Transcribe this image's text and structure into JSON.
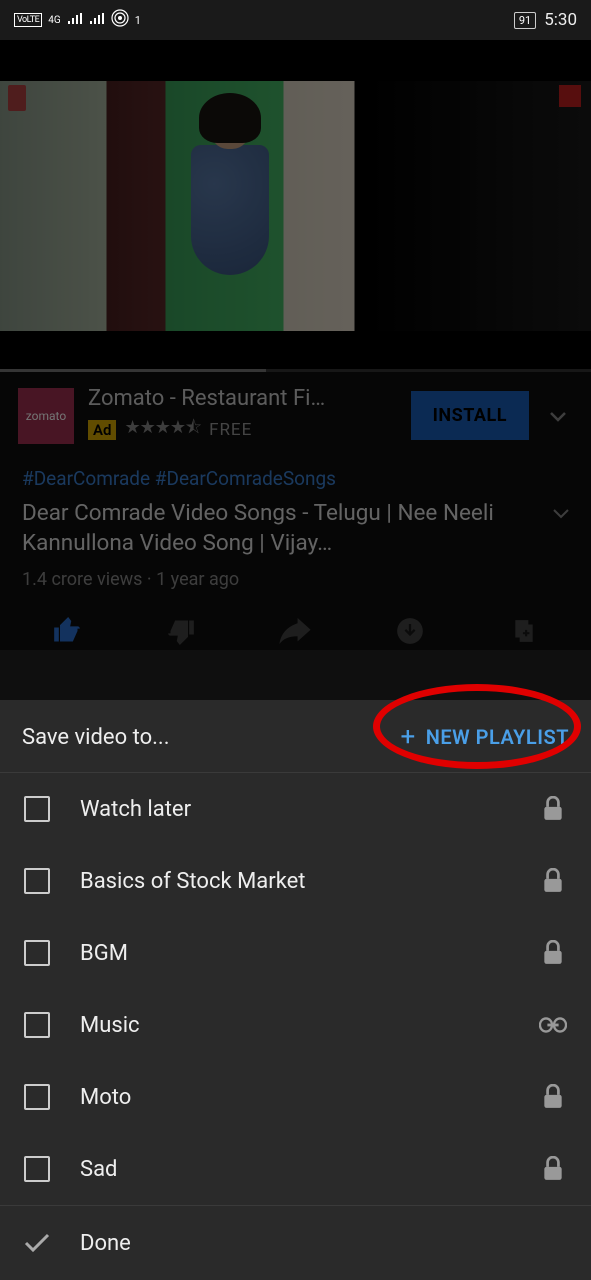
{
  "status": {
    "volte": "VoLTE",
    "net": "4G",
    "hotspot": "1",
    "battery": "91",
    "time": "5:30"
  },
  "progress": {
    "played_pct": 25,
    "buffer_pct": 45
  },
  "ad": {
    "brand": "zomato",
    "title": "Zomato - Restaurant Fi…",
    "badge": "Ad",
    "stars": "★★★★⯪",
    "price": "FREE",
    "cta": "INSTALL"
  },
  "video": {
    "hashtags": "#DearComrade #DearComradeSongs",
    "title": "Dear Comrade Video Songs - Telugu | Nee Neeli Kannullona Video Song | Vijay…",
    "stats": "1.4 crore views · 1 year ago"
  },
  "sheet": {
    "title": "Save video to...",
    "new_label": "NEW PLAYLIST",
    "items": [
      {
        "label": "Watch later",
        "privacy": "lock"
      },
      {
        "label": "Basics of Stock Market",
        "privacy": "lock"
      },
      {
        "label": "BGM",
        "privacy": "lock"
      },
      {
        "label": "Music",
        "privacy": "link"
      },
      {
        "label": "Moto",
        "privacy": "lock"
      },
      {
        "label": "Sad",
        "privacy": "lock"
      }
    ],
    "done": "Done"
  }
}
